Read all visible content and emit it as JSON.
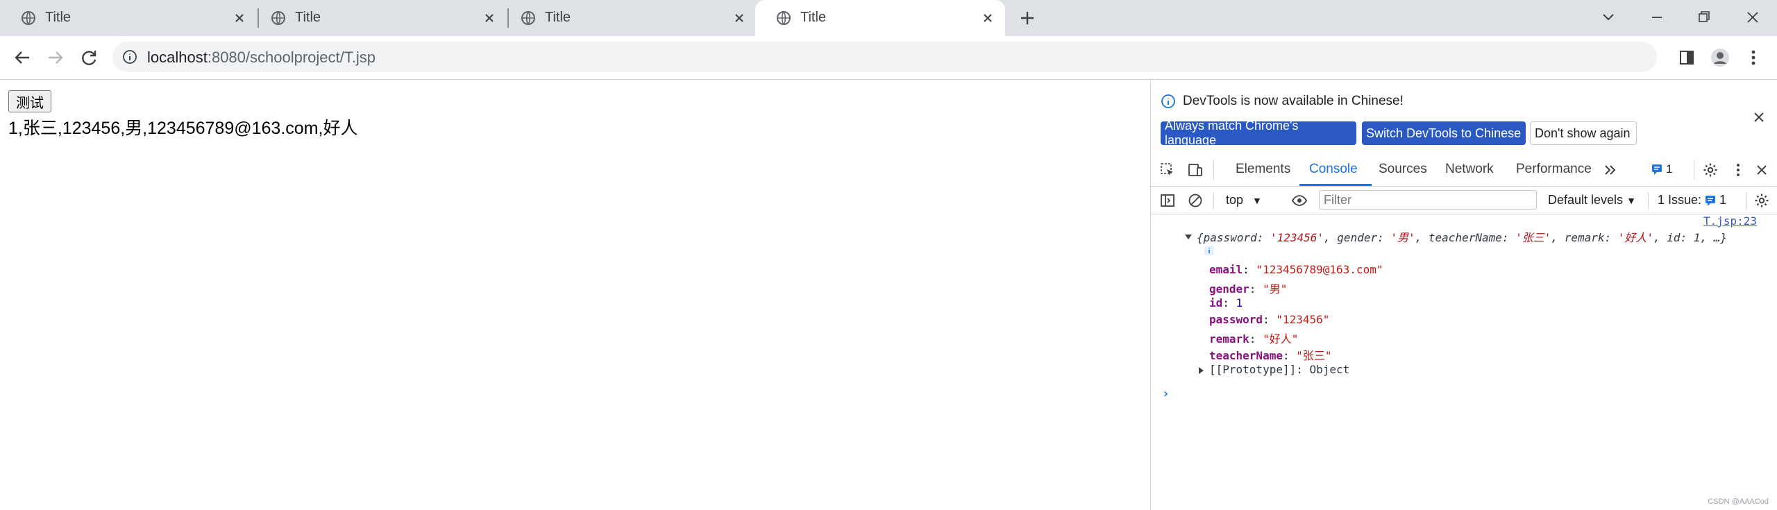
{
  "tabs": [
    {
      "title": "Title",
      "active": false
    },
    {
      "title": "Title",
      "active": false
    },
    {
      "title": "Title",
      "active": false
    },
    {
      "title": "Title",
      "active": true
    }
  ],
  "address": {
    "host": "localhost",
    "path": ":8080/schoolproject/T.jsp"
  },
  "page": {
    "button_label": "测试",
    "result_text": "1,张三,123456,男,123456789@163.com,好人"
  },
  "devtools": {
    "notice": "DevTools is now available in Chinese!",
    "btn_match": "Always match Chrome's language",
    "btn_switch": "Switch DevTools to Chinese",
    "btn_dismiss": "Don't show again",
    "tabs": [
      "Elements",
      "Console",
      "Sources",
      "Network",
      "Performance"
    ],
    "active_tab": "Console",
    "message_badge": "1",
    "console_bar": {
      "context": "top",
      "filter_placeholder": "Filter",
      "levels": "Default levels",
      "issues_label": "1 Issue:",
      "issues_count": "1"
    },
    "console": {
      "source_link": "T.jsp:23",
      "summary": {
        "p1": "{password: ",
        "v1": "'123456'",
        "p2": ", gender: ",
        "v2": "'男'",
        "p3": ", teacherName: ",
        "v3": "'张三'",
        "p4": ", remark: ",
        "v4": "'好人'",
        "p5": ", id: 1, …}"
      },
      "properties": [
        {
          "key": "email",
          "value": "\"123456789@163.com\"",
          "type": "str"
        },
        {
          "key": "gender",
          "value": "\"男\"",
          "type": "str"
        },
        {
          "key": "id",
          "value": "1",
          "type": "num"
        },
        {
          "key": "password",
          "value": "\"123456\"",
          "type": "str"
        },
        {
          "key": "remark",
          "value": "\"好人\"",
          "type": "str"
        },
        {
          "key": "teacherName",
          "value": "\"张三\"",
          "type": "str"
        }
      ],
      "prototype": "[[Prototype]]: Object",
      "prompt": "›"
    }
  },
  "watermark": "CSDN @AAACod",
  "colors": {
    "accent": "#1a73e8",
    "devtools_button": "#2b59c3",
    "tab_strip": "#dee1e6"
  }
}
